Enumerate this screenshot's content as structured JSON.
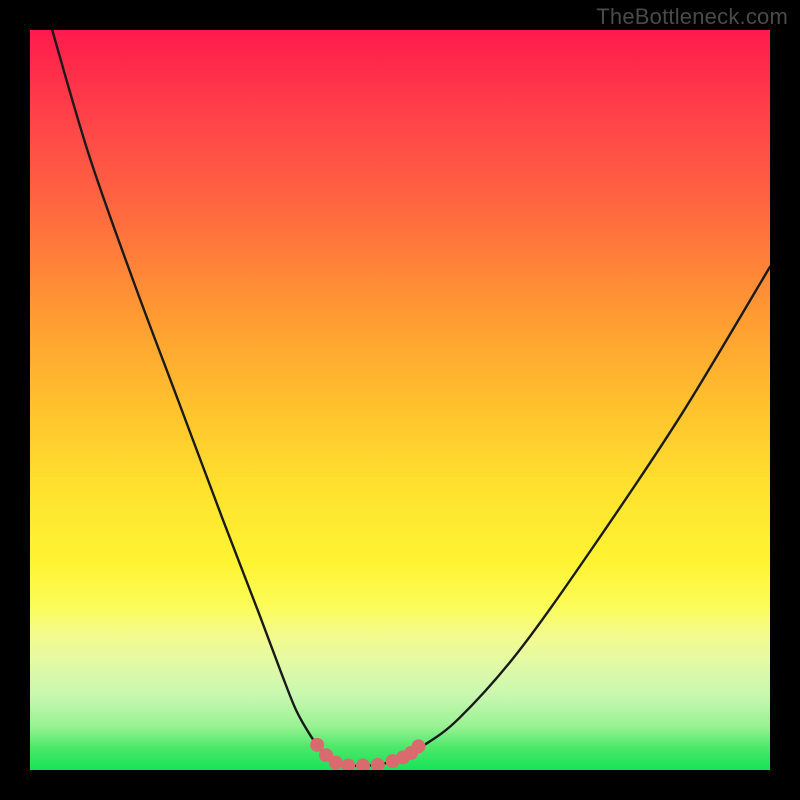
{
  "watermark": "TheBottleneck.com",
  "chart_data": {
    "type": "line",
    "title": "",
    "xlabel": "",
    "ylabel": "",
    "xlim": [
      0,
      100
    ],
    "ylim": [
      0,
      100
    ],
    "grid": false,
    "legend": false,
    "series": [
      {
        "name": "bottleneck-curve",
        "x": [
          3,
          8,
          14,
          20,
          26,
          31,
          34,
          36,
          38,
          39.5,
          41,
          43,
          45,
          47,
          49.5,
          53,
          58,
          66,
          76,
          88,
          100
        ],
        "y": [
          100,
          83,
          66,
          50,
          34,
          21,
          13,
          8,
          4.5,
          2.5,
          1.2,
          0.6,
          0.6,
          0.7,
          1.4,
          3.2,
          7,
          16,
          30,
          48,
          68
        ],
        "color": "#1a1a1a",
        "width": 2.4
      }
    ],
    "markers": {
      "name": "optimal-zone",
      "points": [
        {
          "x": 38.8,
          "y": 3.4
        },
        {
          "x": 40.0,
          "y": 2.0
        },
        {
          "x": 41.3,
          "y": 1.0
        },
        {
          "x": 43.0,
          "y": 0.6
        },
        {
          "x": 45.0,
          "y": 0.6
        },
        {
          "x": 47.0,
          "y": 0.7
        },
        {
          "x": 49.0,
          "y": 1.2
        },
        {
          "x": 50.4,
          "y": 1.7
        },
        {
          "x": 51.5,
          "y": 2.3
        },
        {
          "x": 52.5,
          "y": 3.2
        }
      ],
      "color": "#d96b6f",
      "radius_outer": 9,
      "radius_inner": 7
    },
    "gradient_stops": [
      {
        "pos": 0,
        "color": "#ff1a4d"
      },
      {
        "pos": 14,
        "color": "#ff4948"
      },
      {
        "pos": 38,
        "color": "#ff9933"
      },
      {
        "pos": 62,
        "color": "#ffe22e"
      },
      {
        "pos": 82,
        "color": "#f2fb8f"
      },
      {
        "pos": 94,
        "color": "#9af294"
      },
      {
        "pos": 100,
        "color": "#17e356"
      }
    ]
  }
}
